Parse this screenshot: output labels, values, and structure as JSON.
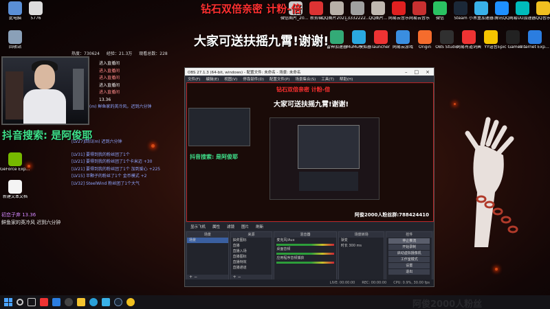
{
  "desktop_icons": [
    {
      "name": "此电脑",
      "color": "#5a8fd6"
    },
    {
      "name": "5776",
      "color": "#dddddd"
    },
    {
      "name": "回收站",
      "color": "#8aa0b8"
    },
    {
      "name": "GeForce Experience",
      "color": "#76b900"
    },
    {
      "name": "新建文本文档",
      "color": "#f4f4f4"
    }
  ],
  "top_icons": [
    {
      "name": "微信图片_2022062...",
      "color": "#c8c8c8"
    },
    {
      "name": "新剪辑",
      "color": "#d33"
    },
    {
      "name": "QQ图片20211223...",
      "color": "#b8b0a8"
    },
    {
      "name": "_3332222...",
      "color": "#a0a0a0"
    },
    {
      "name": "QQ图片...",
      "color": "#c0b8b0"
    },
    {
      "name": "网易云音乐",
      "color": "#e02020"
    },
    {
      "name": "网易云音乐",
      "color": "#c83030"
    },
    {
      "name": "微信",
      "color": "#2ac262"
    },
    {
      "name": "Steam",
      "color": "#1b2838"
    },
    {
      "name": "小黑盒加速器",
      "color": "#39b1e8"
    },
    {
      "name": "腾讯QQ",
      "color": "#1e90ff"
    },
    {
      "name": "网易UU加速器",
      "color": "#0bb"
    },
    {
      "name": "QQ音乐",
      "color": "#f0c020"
    }
  ],
  "top_icons_row2": [
    {
      "name": "雷神加速器",
      "color": "#3a7"
    },
    {
      "name": "MuMu模拟器",
      "color": "#2aa8e0"
    },
    {
      "name": "launcher",
      "color": "#e33"
    },
    {
      "name": "网易云游戏",
      "color": "#3a8ee0"
    },
    {
      "name": "Origin",
      "color": "#f56c2d"
    },
    {
      "name": "OBS Studio",
      "color": "#303030"
    },
    {
      "name": "网易有道词典",
      "color": "#e33"
    },
    {
      "name": "YY语音",
      "color": "#f5c400"
    },
    {
      "name": "Epic Games Launcher",
      "color": "#222"
    },
    {
      "name": "Internet Explorer",
      "color": "#2b7de0"
    }
  ],
  "banners": {
    "top": "钻石双倍亲密 计粉-倍",
    "mid": "大家可送扶摇九霄!谢谢!",
    "bottom": "阿俊2000人粉丝群:788424410"
  },
  "stream": {
    "stats": [
      "热度：730624",
      "经验：21.3万",
      "观看总数：228"
    ],
    "chat_lines": [
      "进入直播间",
      "进入直播间",
      "进入直播间",
      "进入直播间",
      "进入直播间",
      "13.36",
      "(m) 鲜鱼家的英冷风，迟到六分钟"
    ],
    "search_label": "抖音搜索: 是阿俊耶",
    "chat2_lines": [
      "[LV27]回归(m) 迟到六分钟",
      "[LV31] 要得到我的粉丝团了1个",
      "[LV21] 要得到我的粉丝团了1个卡米迈 +30",
      "[LV21] 要得到我的粉丝团了1个 加到爱心 +225",
      "[LV15] 半颗子的粉丝了1个 金币模式 +2",
      "[LV32] SteelWind 粉丝团了1个大气"
    ],
    "gift_user": "初恋子弃 13.36",
    "gift_text": "鲜鱼家的英冷风  迟到六分钟"
  },
  "obs": {
    "title": "OBS 27.1.3 (64-bit, windows) - 配置文件: 未命名 - 场景: 未命名",
    "menu": [
      "文件(F)",
      "编辑(E)",
      "视图(V)",
      "停靠部件(D)",
      "配置文件(P)",
      "场景集合(S)",
      "工具(T)",
      "帮助(H)"
    ],
    "scene_bar": [
      "显示飞机",
      "属性",
      "滤镜",
      "图片",
      "刷新"
    ],
    "docks": {
      "scenes": {
        "title": "场景",
        "items": [
          "场景"
        ]
      },
      "sources": {
        "title": "来源",
        "items": [
          "抽奖图标",
          "直播",
          "直播入场",
          "直播图标",
          "直播特效",
          "直播通道"
        ]
      },
      "mixer": {
        "title": "混音器",
        "items": [
          "麦克风/Aux",
          "桌面音频",
          "应用程序音频捕获"
        ]
      },
      "transitions": {
        "title": "场景转场",
        "items": [
          "渐变",
          "时长  300 ms"
        ]
      },
      "controls": {
        "title": "控件",
        "items": [
          "停止推流",
          "开始录制",
          "启动虚拟摄像机",
          "工作室模式",
          "设置",
          "退出"
        ]
      }
    },
    "status": [
      "LIVE: 00:00:00",
      "REC: 00:00:00",
      "CPU: 0.9%, 30.00 fps"
    ]
  }
}
